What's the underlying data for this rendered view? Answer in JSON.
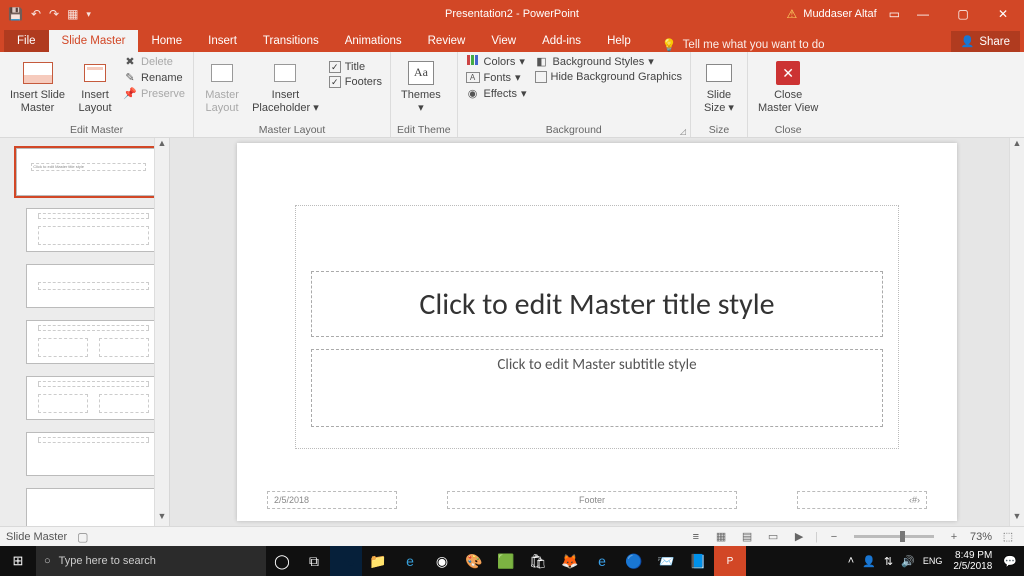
{
  "titlebar": {
    "doc_title": "Presentation2 - PowerPoint",
    "user_name": "Muddaser Altaf"
  },
  "tabs": {
    "file": "File",
    "slide_master": "Slide Master",
    "home": "Home",
    "insert": "Insert",
    "transitions": "Transitions",
    "animations": "Animations",
    "review": "Review",
    "view": "View",
    "addins": "Add-ins",
    "help": "Help",
    "tellme": "Tell me what you want to do",
    "share": "Share"
  },
  "ribbon": {
    "edit_master": {
      "insert_slide_master": "Insert Slide\nMaster",
      "insert_layout": "Insert\nLayout",
      "delete": "Delete",
      "rename": "Rename",
      "preserve": "Preserve",
      "label": "Edit Master"
    },
    "master_layout": {
      "master_layout": "Master\nLayout",
      "insert_placeholder": "Insert\nPlaceholder",
      "title": "Title",
      "footers": "Footers",
      "label": "Master Layout"
    },
    "edit_theme": {
      "themes": "Themes",
      "label": "Edit Theme"
    },
    "background": {
      "colors": "Colors",
      "fonts": "Fonts",
      "effects": "Effects",
      "bg_styles": "Background Styles",
      "hide_bg": "Hide Background Graphics",
      "label": "Background"
    },
    "size": {
      "slide_size": "Slide\nSize",
      "label": "Size"
    },
    "close": {
      "close_master": "Close\nMaster View",
      "label": "Close"
    }
  },
  "slide": {
    "title_placeholder": "Click to edit Master title style",
    "subtitle_placeholder": "Click to edit Master subtitle style",
    "date": "2/5/2018",
    "footer": "Footer",
    "slidenum": "‹#›"
  },
  "statusbar": {
    "view_label": "Slide Master",
    "zoom": "73%"
  },
  "taskbar": {
    "search_placeholder": "Type here to search",
    "time": "8:49 PM",
    "date": "2/5/2018"
  }
}
